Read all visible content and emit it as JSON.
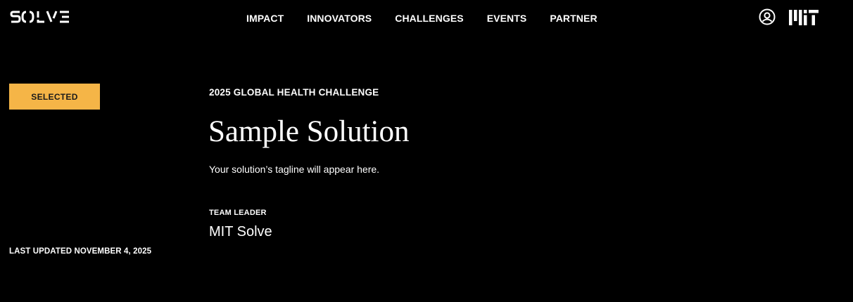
{
  "header": {
    "logo_text": "SOLVE",
    "nav": [
      {
        "label": "IMPACT"
      },
      {
        "label": "INNOVATORS"
      },
      {
        "label": "CHALLENGES"
      },
      {
        "label": "EVENTS"
      },
      {
        "label": "PARTNER"
      }
    ],
    "user_icon": "user-circle-icon",
    "mit_logo_text": "MIT"
  },
  "solution": {
    "status": "SELECTED",
    "status_color": "#f5b547",
    "challenge": "2025 GLOBAL HEALTH CHALLENGE",
    "title": "Sample Solution",
    "tagline": "Your solution’s tagline will appear here.",
    "team_leader_label": "TEAM LEADER",
    "team_leader_name": "MIT Solve",
    "last_updated": "LAST UPDATED NOVEMBER 4, 2025"
  }
}
